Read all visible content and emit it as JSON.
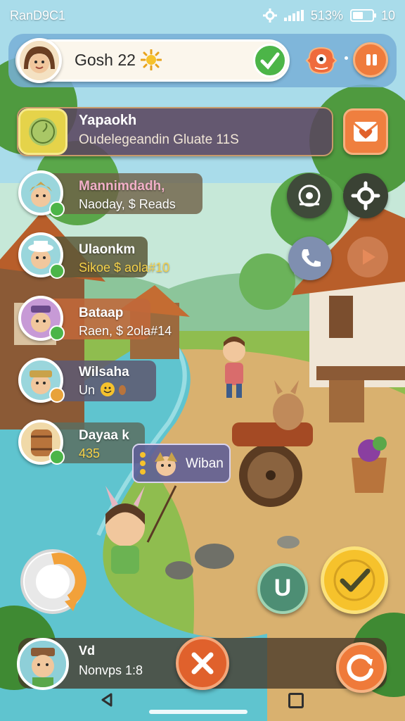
{
  "status_bar": {
    "carrier": "RanD9C1",
    "battery_text": "513%",
    "time": "10",
    "battery_level": 0.55
  },
  "player": {
    "name": "Gosh 22",
    "icon": "sun-icon"
  },
  "quest": {
    "title": "Yapaokh",
    "subtitle": "Oudelegeandin Gluate 11S"
  },
  "villagers": [
    {
      "name": "Mannimdadh,",
      "status": "Naoday, $ Reads",
      "badge_color": "#4cb548",
      "card_color": "#9a7b4b"
    },
    {
      "name": "Ulaonkm",
      "status": "Sikoe $ aola#10",
      "badge_color": "#4cb548",
      "card_color": "#6d6a44"
    },
    {
      "name": "Bataap",
      "status": "Raen, $ 2ola#14",
      "badge_color": "#4cb548",
      "card_color": "#c0683a"
    },
    {
      "name": "Wilsaha",
      "status": "Un",
      "badge_color": "#e8a23a",
      "card_color": "#5f5a72"
    },
    {
      "name": "Dayaa k",
      "status": "435",
      "badge_color": "#4cb548",
      "card_color": "#5b6f60"
    }
  ],
  "floating_tag": {
    "label": "Wiban"
  },
  "bottom": {
    "title": "Vd",
    "subtitle": "Nonvps 1:8"
  },
  "colors": {
    "accent_orange": "#ef7b3c",
    "accent_green": "#4cb548",
    "accent_yellow": "#f6c22c"
  }
}
